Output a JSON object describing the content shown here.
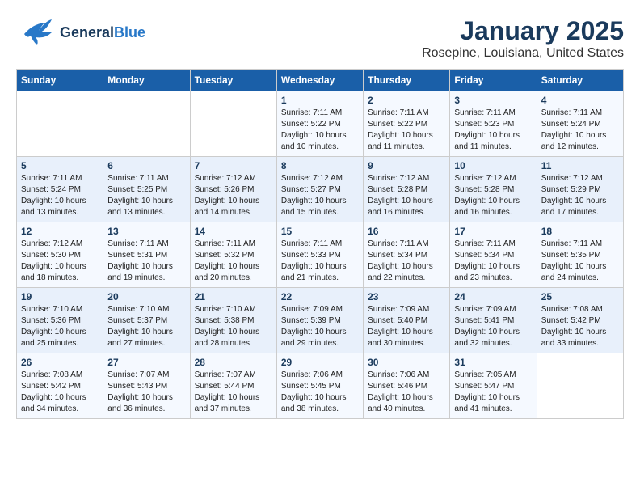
{
  "header": {
    "logo_general": "General",
    "logo_blue": "Blue",
    "main_title": "January 2025",
    "subtitle": "Rosepine, Louisiana, United States"
  },
  "days_of_week": [
    "Sunday",
    "Monday",
    "Tuesday",
    "Wednesday",
    "Thursday",
    "Friday",
    "Saturday"
  ],
  "weeks": [
    [
      {
        "day": "",
        "info": ""
      },
      {
        "day": "",
        "info": ""
      },
      {
        "day": "",
        "info": ""
      },
      {
        "day": "1",
        "info": "Sunrise: 7:11 AM\nSunset: 5:22 PM\nDaylight: 10 hours\nand 10 minutes."
      },
      {
        "day": "2",
        "info": "Sunrise: 7:11 AM\nSunset: 5:22 PM\nDaylight: 10 hours\nand 11 minutes."
      },
      {
        "day": "3",
        "info": "Sunrise: 7:11 AM\nSunset: 5:23 PM\nDaylight: 10 hours\nand 11 minutes."
      },
      {
        "day": "4",
        "info": "Sunrise: 7:11 AM\nSunset: 5:24 PM\nDaylight: 10 hours\nand 12 minutes."
      }
    ],
    [
      {
        "day": "5",
        "info": "Sunrise: 7:11 AM\nSunset: 5:24 PM\nDaylight: 10 hours\nand 13 minutes."
      },
      {
        "day": "6",
        "info": "Sunrise: 7:11 AM\nSunset: 5:25 PM\nDaylight: 10 hours\nand 13 minutes."
      },
      {
        "day": "7",
        "info": "Sunrise: 7:12 AM\nSunset: 5:26 PM\nDaylight: 10 hours\nand 14 minutes."
      },
      {
        "day": "8",
        "info": "Sunrise: 7:12 AM\nSunset: 5:27 PM\nDaylight: 10 hours\nand 15 minutes."
      },
      {
        "day": "9",
        "info": "Sunrise: 7:12 AM\nSunset: 5:28 PM\nDaylight: 10 hours\nand 16 minutes."
      },
      {
        "day": "10",
        "info": "Sunrise: 7:12 AM\nSunset: 5:28 PM\nDaylight: 10 hours\nand 16 minutes."
      },
      {
        "day": "11",
        "info": "Sunrise: 7:12 AM\nSunset: 5:29 PM\nDaylight: 10 hours\nand 17 minutes."
      }
    ],
    [
      {
        "day": "12",
        "info": "Sunrise: 7:12 AM\nSunset: 5:30 PM\nDaylight: 10 hours\nand 18 minutes."
      },
      {
        "day": "13",
        "info": "Sunrise: 7:11 AM\nSunset: 5:31 PM\nDaylight: 10 hours\nand 19 minutes."
      },
      {
        "day": "14",
        "info": "Sunrise: 7:11 AM\nSunset: 5:32 PM\nDaylight: 10 hours\nand 20 minutes."
      },
      {
        "day": "15",
        "info": "Sunrise: 7:11 AM\nSunset: 5:33 PM\nDaylight: 10 hours\nand 21 minutes."
      },
      {
        "day": "16",
        "info": "Sunrise: 7:11 AM\nSunset: 5:34 PM\nDaylight: 10 hours\nand 22 minutes."
      },
      {
        "day": "17",
        "info": "Sunrise: 7:11 AM\nSunset: 5:34 PM\nDaylight: 10 hours\nand 23 minutes."
      },
      {
        "day": "18",
        "info": "Sunrise: 7:11 AM\nSunset: 5:35 PM\nDaylight: 10 hours\nand 24 minutes."
      }
    ],
    [
      {
        "day": "19",
        "info": "Sunrise: 7:10 AM\nSunset: 5:36 PM\nDaylight: 10 hours\nand 25 minutes."
      },
      {
        "day": "20",
        "info": "Sunrise: 7:10 AM\nSunset: 5:37 PM\nDaylight: 10 hours\nand 27 minutes."
      },
      {
        "day": "21",
        "info": "Sunrise: 7:10 AM\nSunset: 5:38 PM\nDaylight: 10 hours\nand 28 minutes."
      },
      {
        "day": "22",
        "info": "Sunrise: 7:09 AM\nSunset: 5:39 PM\nDaylight: 10 hours\nand 29 minutes."
      },
      {
        "day": "23",
        "info": "Sunrise: 7:09 AM\nSunset: 5:40 PM\nDaylight: 10 hours\nand 30 minutes."
      },
      {
        "day": "24",
        "info": "Sunrise: 7:09 AM\nSunset: 5:41 PM\nDaylight: 10 hours\nand 32 minutes."
      },
      {
        "day": "25",
        "info": "Sunrise: 7:08 AM\nSunset: 5:42 PM\nDaylight: 10 hours\nand 33 minutes."
      }
    ],
    [
      {
        "day": "26",
        "info": "Sunrise: 7:08 AM\nSunset: 5:42 PM\nDaylight: 10 hours\nand 34 minutes."
      },
      {
        "day": "27",
        "info": "Sunrise: 7:07 AM\nSunset: 5:43 PM\nDaylight: 10 hours\nand 36 minutes."
      },
      {
        "day": "28",
        "info": "Sunrise: 7:07 AM\nSunset: 5:44 PM\nDaylight: 10 hours\nand 37 minutes."
      },
      {
        "day": "29",
        "info": "Sunrise: 7:06 AM\nSunset: 5:45 PM\nDaylight: 10 hours\nand 38 minutes."
      },
      {
        "day": "30",
        "info": "Sunrise: 7:06 AM\nSunset: 5:46 PM\nDaylight: 10 hours\nand 40 minutes."
      },
      {
        "day": "31",
        "info": "Sunrise: 7:05 AM\nSunset: 5:47 PM\nDaylight: 10 hours\nand 41 minutes."
      },
      {
        "day": "",
        "info": ""
      }
    ]
  ]
}
